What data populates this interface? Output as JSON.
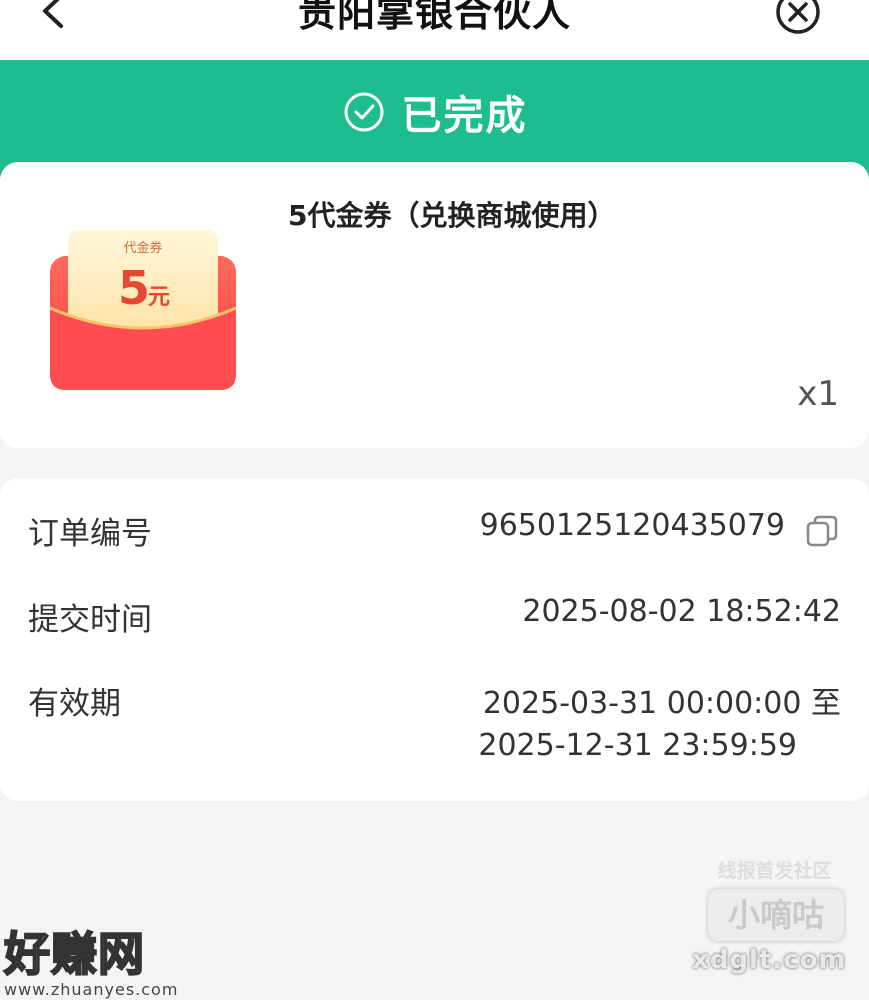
{
  "header": {
    "title": "贵阳掌银合伙人",
    "back_icon": "chevron-left-icon",
    "close_icon": "close-circle-icon"
  },
  "status": {
    "text": "已完成",
    "icon": "check-circle-icon",
    "color": "#1dbd8f"
  },
  "product": {
    "name": "5代金券（兑换商城使用）",
    "quantity": "x1",
    "voucher_image": {
      "tag": "代金券",
      "amount": "5",
      "unit": "元"
    }
  },
  "order": {
    "rows": [
      {
        "label": "订单编号",
        "value": "9650125120435079"
      },
      {
        "label": "提交时间",
        "value": "2025-08-02 18:52:42"
      },
      {
        "label": "有效期",
        "value_line1": "2025-03-31 00:00:00 至",
        "value_line2": "2025-12-31 23:59:59"
      }
    ],
    "copy_icon": "copy-icon"
  },
  "watermarks": {
    "left_big": "好赚网",
    "left_url": "www.zhuanyes.com",
    "right_top": "线报首发社区",
    "right_box": "小嘀咕",
    "right_url": "xdglt.com"
  }
}
